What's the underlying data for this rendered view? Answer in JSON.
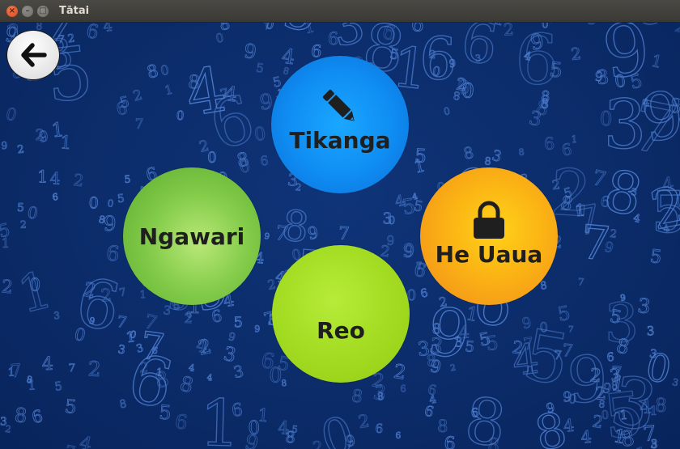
{
  "window": {
    "title": "Tātai",
    "controls": {
      "close": "×",
      "minimize": "–",
      "maximize": "□"
    }
  },
  "back_button": {
    "icon": "arrow-left-icon"
  },
  "bubbles": {
    "tikanga": {
      "label": "Tikanga",
      "icon": "pencil-icon",
      "color": "#0f8cf2"
    },
    "ngawari": {
      "label": "Ngawari",
      "color": "#84cc4a"
    },
    "he_uaua": {
      "label": "He Uaua",
      "icon": "lock-icon",
      "color": "#fbb314"
    },
    "reo": {
      "label": "Reo",
      "color": "#a3dc22"
    }
  },
  "colors": {
    "background": "#0d2d6e",
    "digits": "#4f7fd0",
    "text": "#1f1f1f"
  }
}
